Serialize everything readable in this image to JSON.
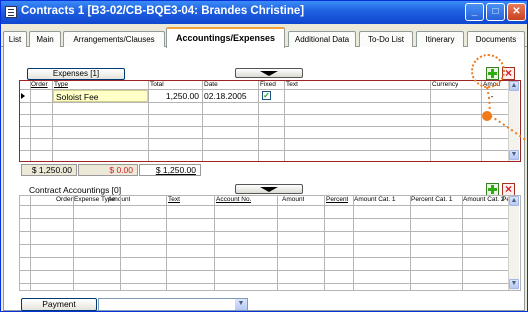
{
  "window": {
    "title": "Contracts  1 [B3-02/CB-BQE3-04: Brandes Christine]",
    "minimize": "_",
    "maximize": "□",
    "close": "✕"
  },
  "tabs": [
    {
      "label": "List"
    },
    {
      "label": "Main"
    },
    {
      "label": "Arrangements/Clauses"
    },
    {
      "label": "Accountings/Expenses",
      "active": true
    },
    {
      "label": "Additional Data"
    },
    {
      "label": "To-Do List"
    },
    {
      "label": "Itinerary"
    },
    {
      "label": "Documents"
    }
  ],
  "expenses": {
    "button_label": "Expenses  [1]",
    "columns": [
      "Order",
      "Type",
      "Total",
      "Date",
      "Fixed",
      "Text",
      "Currency",
      "Amou"
    ],
    "rows": [
      {
        "order": "",
        "type": "Soloist Fee",
        "total": "1,250.00",
        "date": "02.18.2005",
        "fixed": true,
        "text": "",
        "currency": "",
        "amount": "-"
      }
    ],
    "totals": {
      "total": "$ 1,250.00",
      "open": "$ 0.00",
      "paid": "$ 1,250.00"
    }
  },
  "contract_accountings": {
    "label": "Contract Accountings  [0]",
    "columns": [
      "Order",
      "Expense Type",
      "Amount",
      "Text",
      "Account No.",
      "Amount",
      "Percent",
      "Amount Cat. 1",
      "Percent Cat. 1",
      "Amount Cat. 2",
      "Perc"
    ]
  },
  "payment": {
    "button_label": "Payment",
    "select_value": ""
  },
  "icons": {
    "add": "plus-icon",
    "delete": "close-icon",
    "toggle": "triangle-down-icon"
  },
  "colors": {
    "titlebar": "#1f5fe0",
    "active_tab_accent": "#f2a43a",
    "grid_frame": "#9c2424",
    "selected_cell": "#ffffc8",
    "highlight": "#f07a18",
    "open_amount": "#d2202a"
  }
}
